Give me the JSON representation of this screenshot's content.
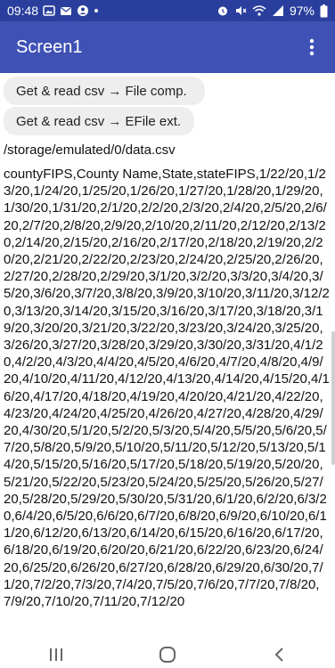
{
  "status_bar": {
    "time": "09:48",
    "battery": "97%",
    "icons": [
      "image-icon",
      "mail-icon",
      "account-icon",
      "dot-icon",
      "alarm-icon",
      "mute-icon",
      "wifi-icon",
      "signal-icon",
      "battery-icon"
    ]
  },
  "app_bar": {
    "title": "Screen1",
    "menu_icon": "more-vert-icon"
  },
  "buttons": {
    "read_file_comp": "Get & read csv → File comp.",
    "read_efile_ext": "Get & read csv → EFile ext."
  },
  "file_path": "/storage/emulated/0/data.csv",
  "csv_content": "countyFIPS,County Name,State,stateFIPS,1/22/20,1/23/20,1/24/20,1/25/20,1/26/20,1/27/20,1/28/20,1/29/20,1/30/20,1/31/20,2/1/20,2/2/20,2/3/20,2/4/20,2/5/20,2/6/20,2/7/20,2/8/20,2/9/20,2/10/20,2/11/20,2/12/20,2/13/20,2/14/20,2/15/20,2/16/20,2/17/20,2/18/20,2/19/20,2/20/20,2/21/20,2/22/20,2/23/20,2/24/20,2/25/20,2/26/20,2/27/20,2/28/20,2/29/20,3/1/20,3/2/20,3/3/20,3/4/20,3/5/20,3/6/20,3/7/20,3/8/20,3/9/20,3/10/20,3/11/20,3/12/20,3/13/20,3/14/20,3/15/20,3/16/20,3/17/20,3/18/20,3/19/20,3/20/20,3/21/20,3/22/20,3/23/20,3/24/20,3/25/20,3/26/20,3/27/20,3/28/20,3/29/20,3/30/20,3/31/20,4/1/20,4/2/20,4/3/20,4/4/20,4/5/20,4/6/20,4/7/20,4/8/20,4/9/20,4/10/20,4/11/20,4/12/20,4/13/20,4/14/20,4/15/20,4/16/20,4/17/20,4/18/20,4/19/20,4/20/20,4/21/20,4/22/20,4/23/20,4/24/20,4/25/20,4/26/20,4/27/20,4/28/20,4/29/20,4/30/20,5/1/20,5/2/20,5/3/20,5/4/20,5/5/20,5/6/20,5/7/20,5/8/20,5/9/20,5/10/20,5/11/20,5/12/20,5/13/20,5/14/20,5/15/20,5/16/20,5/17/20,5/18/20,5/19/20,5/20/20,5/21/20,5/22/20,5/23/20,5/24/20,5/25/20,5/26/20,5/27/20,5/28/20,5/29/20,5/30/20,5/31/20,6/1/20,6/2/20,6/3/20,6/4/20,6/5/20,6/6/20,6/7/20,6/8/20,6/9/20,6/10/20,6/11/20,6/12/20,6/13/20,6/14/20,6/15/20,6/16/20,6/17/20,6/18/20,6/19/20,6/20/20,6/21/20,6/22/20,6/23/20,6/24/20,6/25/20,6/26/20,6/27/20,6/28/20,6/29/20,6/30/20,7/1/20,7/2/20,7/3/20,7/4/20,7/5/20,7/6/20,7/7/20,7/8/20,7/9/20,7/10/20,7/11/20,7/12/20",
  "nav_bar": {
    "icons": [
      "recent-apps-icon",
      "home-icon",
      "back-icon"
    ]
  },
  "colors": {
    "status_bar": "#2a3f9d",
    "app_bar": "#3f51b5",
    "button_bg": "#eeeeee"
  }
}
